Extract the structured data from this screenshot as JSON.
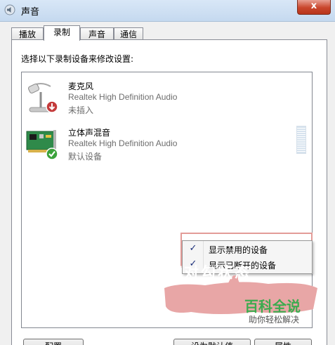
{
  "window": {
    "title": "声音",
    "close_label": "x"
  },
  "tabs": [
    {
      "label": "播放"
    },
    {
      "label": "录制"
    },
    {
      "label": "声音"
    },
    {
      "label": "通信"
    }
  ],
  "panel": {
    "instruction": "选择以下录制设备来修改设置:"
  },
  "devices": [
    {
      "name": "麦克风",
      "description": "Realtek High Definition Audio",
      "status": "未插入",
      "icon": "microphone-icon",
      "status_icon": "unplugged-badge-icon"
    },
    {
      "name": "立体声混音",
      "description": "Realtek High Definition Audio",
      "status": "默认设备",
      "icon": "sound-card-icon",
      "status_icon": "default-check-icon"
    }
  ],
  "context_menu": {
    "items": [
      {
        "label": "显示禁用的设备",
        "checked": true
      },
      {
        "label": "显示已断开的设备",
        "checked": true
      }
    ]
  },
  "annotation": {
    "text": "打对勾状态",
    "color": "#e8a6a6"
  },
  "watermark": {
    "title": "百科全说",
    "subtitle": "助你轻松解决",
    "color": "#3cab4f"
  },
  "bottom_buttons": [
    {
      "label": "配置"
    },
    {
      "label": "设为默认值"
    },
    {
      "label": "属性"
    }
  ]
}
